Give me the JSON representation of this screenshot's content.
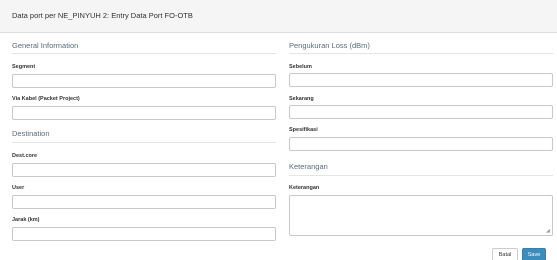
{
  "header": {
    "title": "Data port per NE_PINYUH 2: Entry Data Port FO-OTB"
  },
  "left": {
    "general_title": "General Information",
    "segment_label": "Segment",
    "segment_value": "",
    "via_kabel_label": "Via Kabel (Packet Project)",
    "via_kabel_value": "",
    "destination_title": "Destination",
    "dest_core_label": "Dest.core",
    "dest_core_value": "",
    "user_label": "User",
    "user_value": "",
    "jarak_label": "Jarak (km)",
    "jarak_value": ""
  },
  "right": {
    "loss_title": "Pengukuran Loss (dBm)",
    "sebelum_label": "Sebelum",
    "sebelum_value": "",
    "sekarang_label": "Sekarang",
    "sekarang_value": "",
    "spesifikasi_label": "Spesifikasi",
    "spesifikasi_value": "",
    "keterangan_title": "Keterangan",
    "keterangan_label": "Keterangan",
    "keterangan_value": ""
  },
  "footer": {
    "cancel_label": "Batal",
    "save_label": "Save"
  },
  "colors": {
    "primary": "#3c8dbc",
    "header_bg": "#f5f5f5",
    "section_title": "#5a6b7d"
  }
}
